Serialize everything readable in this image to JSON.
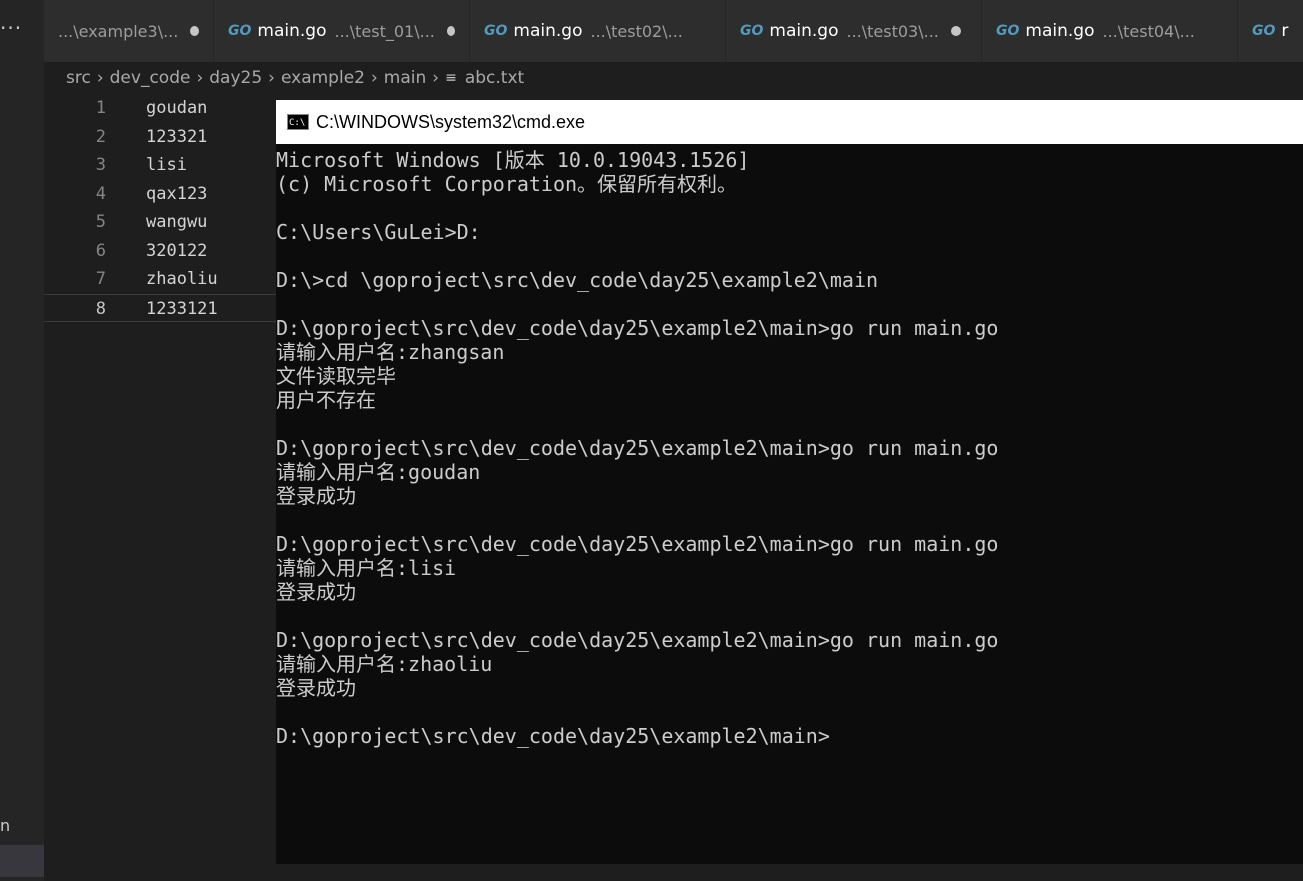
{
  "side": {
    "more": "···",
    "partial_label": "n"
  },
  "tabs": [
    {
      "icon": "go-icon",
      "name": "",
      "path": "...\\example3\\...",
      "dirty": true,
      "partial": true
    },
    {
      "icon": "go-icon",
      "name": "main.go",
      "path": "...\\test_01\\...",
      "dirty": true
    },
    {
      "icon": "go-icon",
      "name": "main.go",
      "path": "...\\test02\\...",
      "dirty": false
    },
    {
      "icon": "go-icon",
      "name": "main.go",
      "path": "...\\test03\\...",
      "dirty": true
    },
    {
      "icon": "go-icon",
      "name": "main.go",
      "path": "...\\test04\\...",
      "dirty": false
    },
    {
      "icon": "go-icon",
      "name": "r",
      "path": "",
      "dirty": false,
      "partial": true
    }
  ],
  "go_badge": "GO",
  "breadcrumb": {
    "parts": [
      "src",
      "dev_code",
      "day25",
      "example2",
      "main"
    ],
    "file": "abc.txt",
    "file_icon": "text-file-icon"
  },
  "editor": {
    "lines": [
      {
        "num": "1",
        "text": "goudan"
      },
      {
        "num": "2",
        "text": "123321"
      },
      {
        "num": "3",
        "text": "lisi"
      },
      {
        "num": "4",
        "text": "qax123"
      },
      {
        "num": "5",
        "text": "wangwu"
      },
      {
        "num": "6",
        "text": "320122"
      },
      {
        "num": "7",
        "text": "zhaoliu"
      },
      {
        "num": "8",
        "text": "1233121"
      }
    ],
    "current_line": "8"
  },
  "cmd": {
    "title": "C:\\WINDOWS\\system32\\cmd.exe",
    "icon_text": "C:\\",
    "lines": [
      "Microsoft Windows [版本 10.0.19043.1526]",
      "(c) Microsoft Corporation。保留所有权利。",
      "",
      "C:\\Users\\GuLei>D:",
      "",
      "D:\\>cd \\goproject\\src\\dev_code\\day25\\example2\\main",
      "",
      "D:\\goproject\\src\\dev_code\\day25\\example2\\main>go run main.go",
      "请输入用户名:zhangsan",
      "文件读取完毕",
      "用户不存在",
      "",
      "D:\\goproject\\src\\dev_code\\day25\\example2\\main>go run main.go",
      "请输入用户名:goudan",
      "登录成功",
      "",
      "D:\\goproject\\src\\dev_code\\day25\\example2\\main>go run main.go",
      "请输入用户名:lisi",
      "登录成功",
      "",
      "D:\\goproject\\src\\dev_code\\day25\\example2\\main>go run main.go",
      "请输入用户名:zhaoliu",
      "登录成功",
      "",
      "D:\\goproject\\src\\dev_code\\day25\\example2\\main>"
    ]
  }
}
